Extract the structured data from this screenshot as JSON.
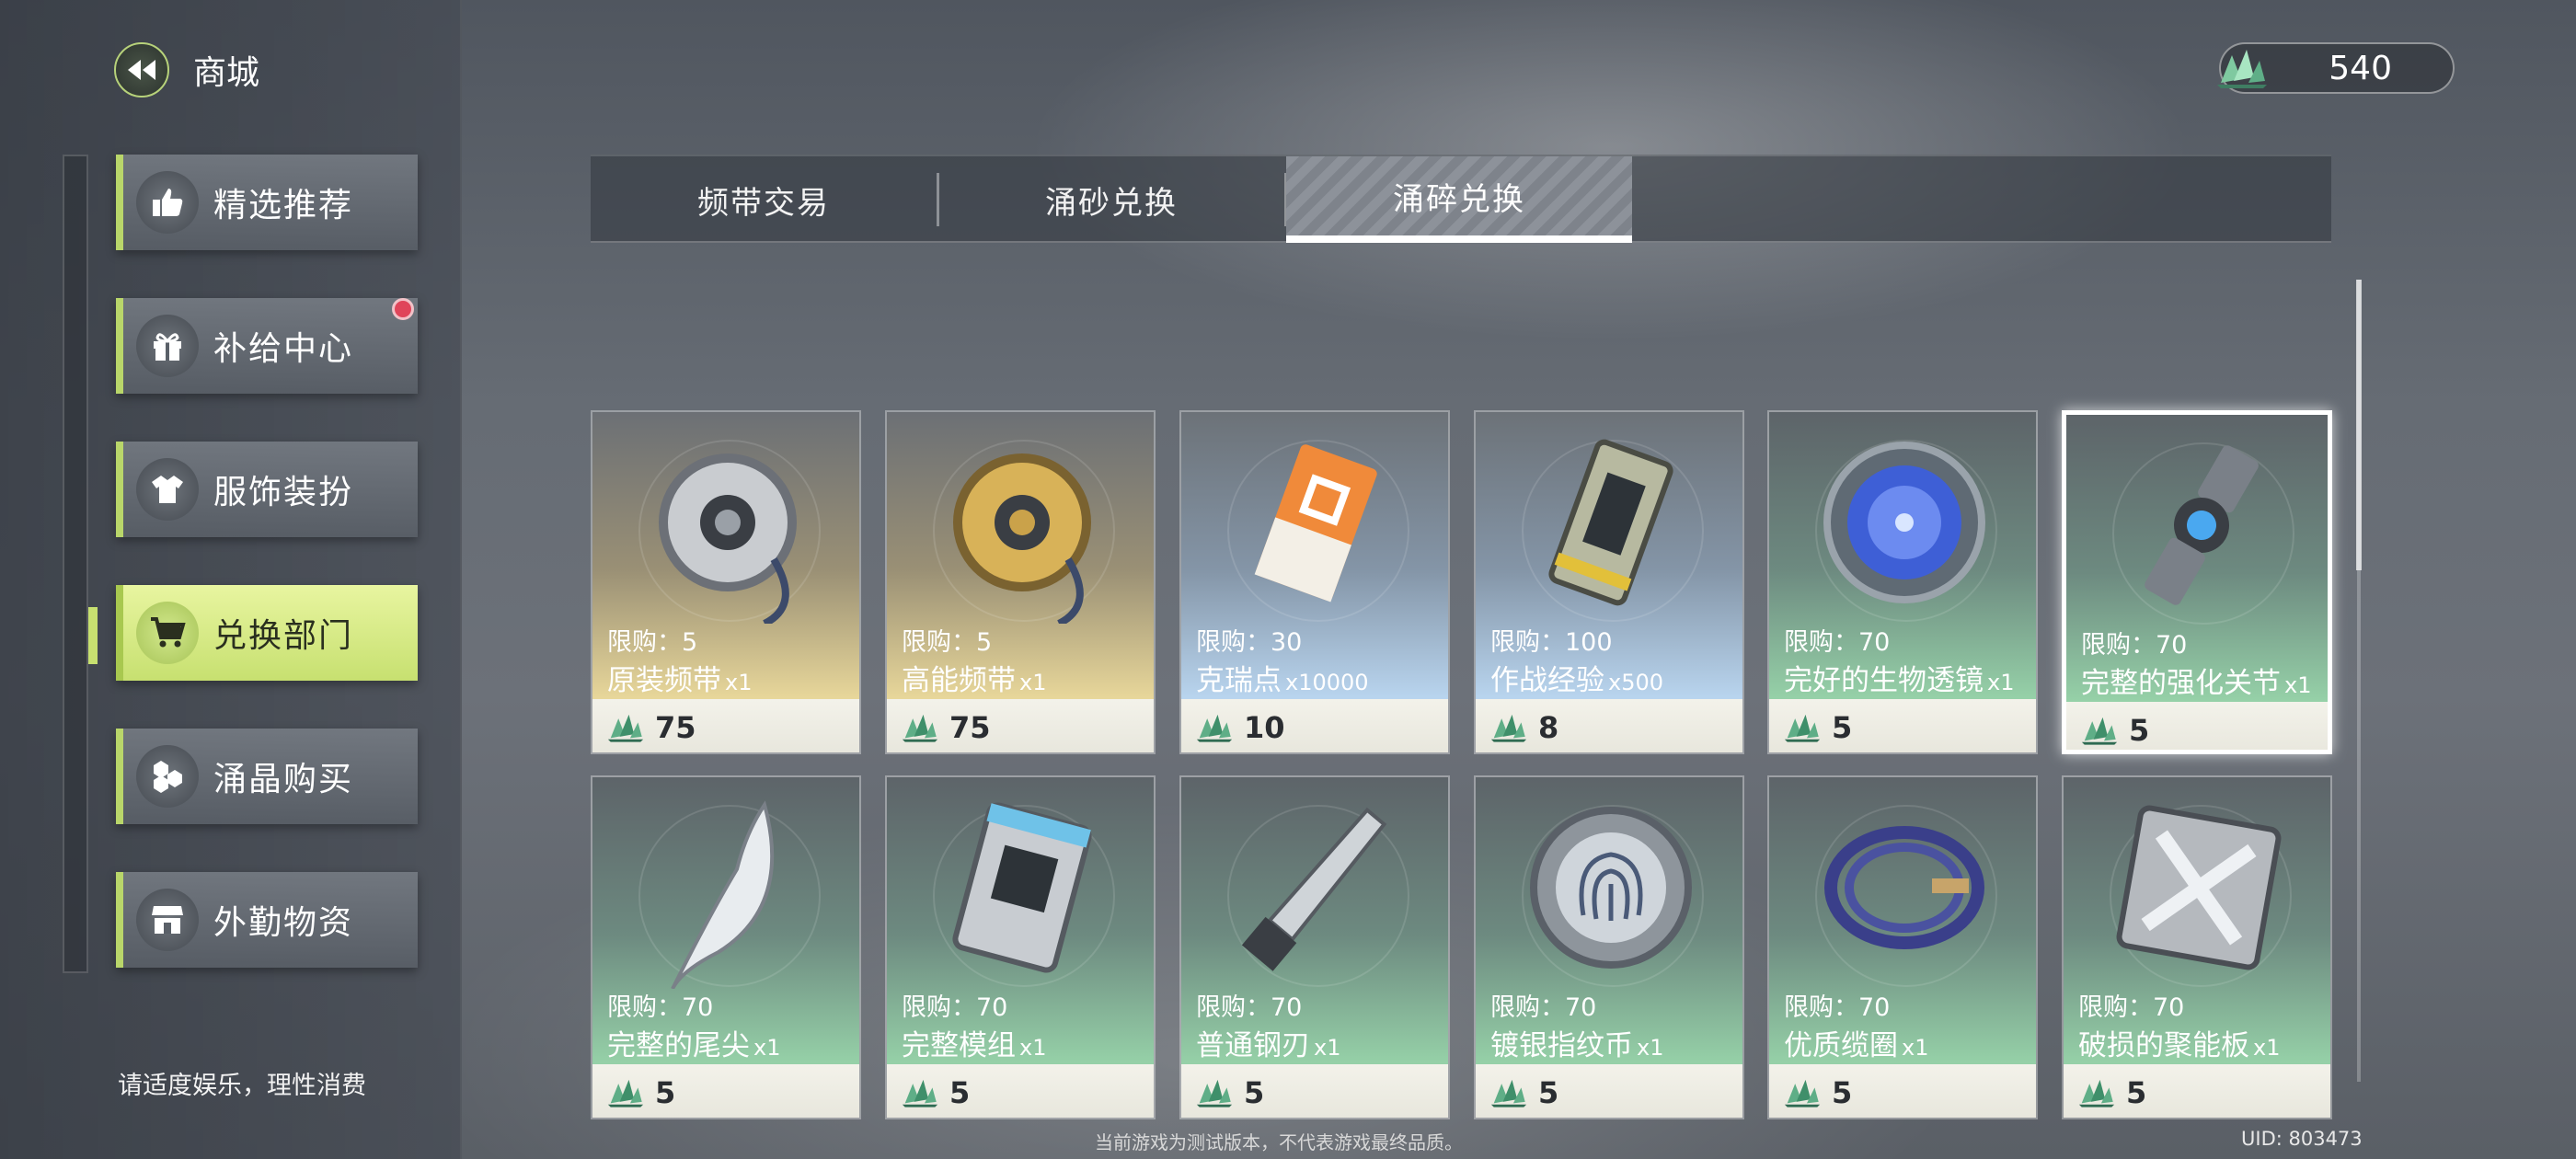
{
  "header": {
    "title": "商城",
    "currency_amount": "540"
  },
  "sidebar": {
    "items": [
      {
        "label": "精选推荐",
        "icon": "thumbs-up-icon"
      },
      {
        "label": "补给中心",
        "icon": "gift-icon",
        "badge": "red-dot"
      },
      {
        "label": "服饰装扮",
        "icon": "shirt-icon"
      },
      {
        "label": "兑换部门",
        "icon": "cart-icon",
        "active": true
      },
      {
        "label": "涌晶购买",
        "icon": "crystals-icon"
      },
      {
        "label": "外勤物资",
        "icon": "store-icon"
      }
    ],
    "notice": "请适度娱乐，理性消费"
  },
  "tabs": [
    {
      "label": "频带交易"
    },
    {
      "label": "涌砂兑换"
    },
    {
      "label": "涌碎兑换",
      "active": true
    }
  ],
  "items": [
    {
      "limit": "限购：5",
      "name": "原装频带",
      "qty": "x1",
      "price": "75",
      "tone": "yellow",
      "icon": "band-disc-icon"
    },
    {
      "limit": "限购：5",
      "name": "高能频带",
      "qty": "x1",
      "price": "75",
      "tone": "yellow",
      "icon": "gold-band-disc-icon"
    },
    {
      "limit": "限购：30",
      "name": "克瑞点",
      "qty": "x10000",
      "price": "10",
      "tone": "blue",
      "icon": "ticket-card-icon"
    },
    {
      "limit": "限购：100",
      "name": "作战经验",
      "qty": "x500",
      "price": "8",
      "tone": "blue",
      "icon": "data-chip-icon"
    },
    {
      "limit": "限购：70",
      "name": "完好的生物透镜",
      "qty": "x1",
      "price": "5",
      "tone": "green",
      "icon": "bio-lens-icon"
    },
    {
      "limit": "限购：70",
      "name": "完整的强化关节",
      "qty": "x1",
      "price": "5",
      "tone": "green",
      "icon": "joint-icon",
      "selected": true
    },
    {
      "limit": "限购：70",
      "name": "完整的尾尖",
      "qty": "x1",
      "price": "5",
      "tone": "green",
      "icon": "tail-tip-icon"
    },
    {
      "limit": "限购：70",
      "name": "完整模组",
      "qty": "x1",
      "price": "5",
      "tone": "green",
      "icon": "module-box-icon"
    },
    {
      "limit": "限购：70",
      "name": "普通钢刃",
      "qty": "x1",
      "price": "5",
      "tone": "green",
      "icon": "steel-blade-icon"
    },
    {
      "limit": "限购：70",
      "name": "镀银指纹币",
      "qty": "x1",
      "price": "5",
      "tone": "green",
      "icon": "fingerprint-coin-icon"
    },
    {
      "limit": "限购：70",
      "name": "优质缆圈",
      "qty": "x1",
      "price": "5",
      "tone": "green",
      "icon": "cable-coil-icon"
    },
    {
      "limit": "限购：70",
      "name": "破损的聚能板",
      "qty": "x1",
      "price": "5",
      "tone": "green",
      "icon": "energy-plate-icon"
    }
  ],
  "footer": {
    "note": "当前游戏为测试版本，不代表游戏最终品质。",
    "uid": "UID: 803473"
  }
}
